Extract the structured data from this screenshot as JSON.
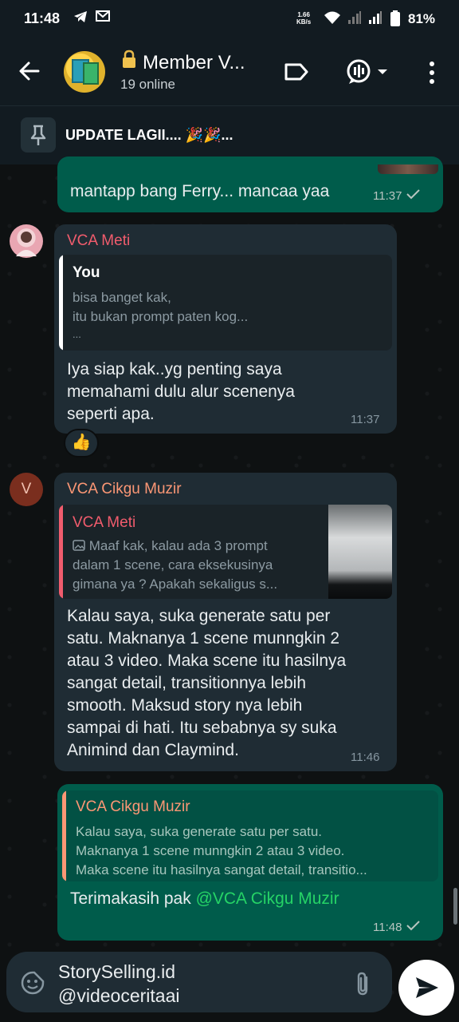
{
  "status_bar": {
    "time": "11:48",
    "net_speed_value": "1.66",
    "net_speed_unit": "KB/s",
    "battery": "81%",
    "icons": [
      "telegram-icon",
      "gmail-icon",
      "wifi-icon",
      "signal-icon",
      "battery-icon"
    ]
  },
  "header": {
    "title": "Member V...",
    "subtitle": "19 online",
    "icons": [
      "back-arrow-icon",
      "label-icon",
      "voice-chat-icon",
      "chevron-down-icon",
      "more-vert-icon"
    ]
  },
  "pinned": {
    "text": "UPDATE LAGII.... 🎉🎉..."
  },
  "messages": [
    {
      "type": "outgoing",
      "text": "mantapp bang Ferry... mancaa yaa",
      "time": "11:37"
    },
    {
      "type": "incoming",
      "sender": "VCA Meti",
      "quote": {
        "name": "You",
        "lines": [
          "bisa banget kak,",
          "itu bukan prompt paten kog...",
          "..."
        ]
      },
      "text_lines": [
        "Iya siap kak..yg penting saya",
        "memahami dulu alur scenenya",
        "seperti apa."
      ],
      "time": "11:37",
      "reaction": "👍"
    },
    {
      "type": "incoming",
      "sender": "VCA Cikgu Muzir",
      "avatar_letter": "V",
      "quote": {
        "name": "VCA Meti",
        "lines": [
          "Maaf kak, kalau ada 3 prompt",
          "dalam 1 scene, cara eksekusinya",
          "gimana ya ? Apakah sekaligus s..."
        ]
      },
      "text_lines": [
        "Kalau saya, suka generate satu per",
        "satu. Maknanya 1 scene munngkin 2",
        "atau 3 video. Maka scene itu hasilnya",
        "sangat detail, transitionnya lebih",
        "smooth. Maksud story nya lebih",
        "sampai di hati. Itu sebabnya sy suka",
        "Animind dan Claymind."
      ],
      "time": "11:46"
    },
    {
      "type": "outgoing",
      "quote": {
        "name": "VCA Cikgu Muzir",
        "lines": [
          "Kalau saya, suka generate satu per satu.",
          "Maknanya 1 scene munngkin 2 atau 3 video.",
          "Maka scene itu hasilnya sangat detail, transitio..."
        ]
      },
      "text": "Terimakasih pak ",
      "mention": "@VCA Cikgu Muzir",
      "time": "11:48"
    }
  ],
  "composer": {
    "line1": "StorySelling.id",
    "line2": "@videoceritaai",
    "icons": [
      "sticker-icon",
      "attach-icon",
      "send-icon"
    ]
  },
  "colors": {
    "outgoing_bubble": "#005c4b",
    "incoming_bubble": "#1f2c34",
    "sender_meti": "#f15c6d",
    "sender_muzir": "#fc9775",
    "accent_green": "#25d366"
  }
}
